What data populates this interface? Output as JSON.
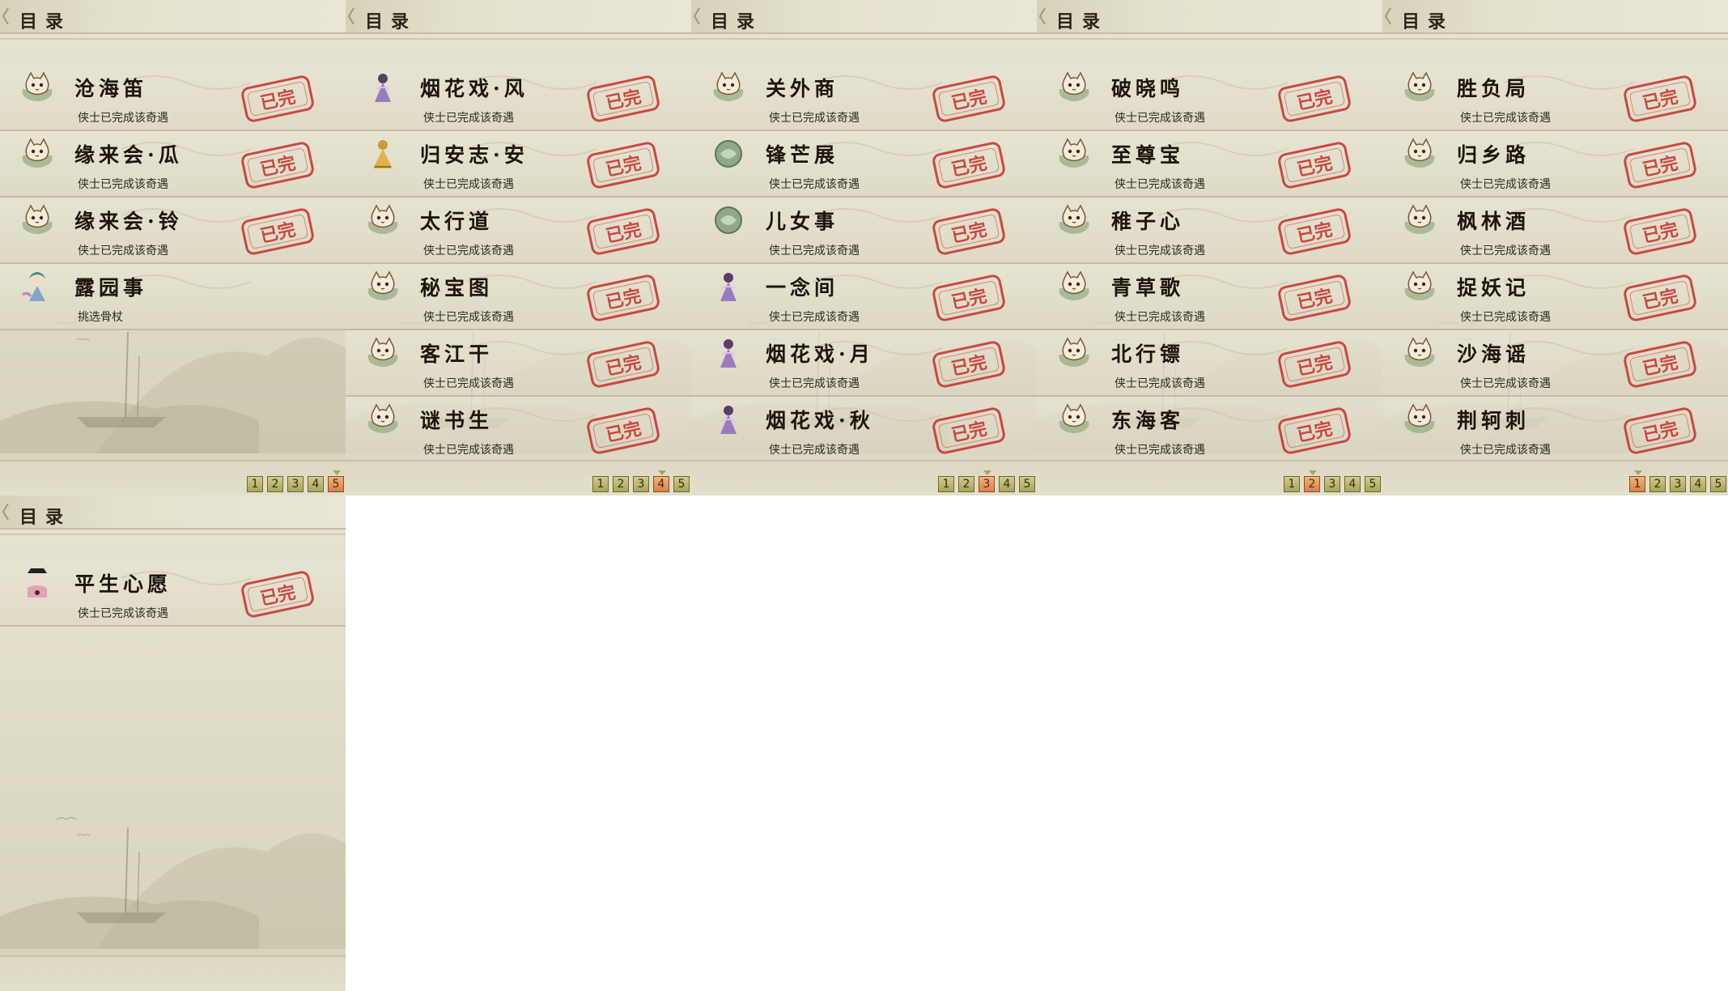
{
  "panel_title": "目录",
  "completed_stamp": "已完",
  "page_numbers": [
    "1",
    "2",
    "3",
    "4",
    "5"
  ],
  "colors": {
    "stamp_red": "#c72d28",
    "page_active": "#e19a62",
    "page_inactive": "#bdb977",
    "parchment": "#e2dfca"
  },
  "panels": [
    {
      "active_page": "5",
      "items": [
        {
          "title": "沧海笛",
          "subtitle": "侠士已完成该奇遇",
          "icon": "cat-avatar-icon",
          "completed": true
        },
        {
          "title": "缘来会·瓜",
          "subtitle": "侠士已完成该奇遇",
          "icon": "cat-avatar-icon",
          "completed": true
        },
        {
          "title": "缘来会·铃",
          "subtitle": "侠士已完成该奇遇",
          "icon": "cat-avatar-icon",
          "completed": true
        },
        {
          "title": "露园事",
          "subtitle": "挑选骨杖",
          "icon": "girl-avatar-icon",
          "completed": false
        }
      ]
    },
    {
      "active_page": "4",
      "items": [
        {
          "title": "烟花戏·风",
          "subtitle": "侠士已完成该奇遇",
          "icon": "purple-lady-avatar-icon",
          "completed": true
        },
        {
          "title": "归安志·安",
          "subtitle": "侠士已完成该奇遇",
          "icon": "golden-figure-avatar-icon",
          "completed": true
        },
        {
          "title": "太行道",
          "subtitle": "侠士已完成该奇遇",
          "icon": "cat-avatar-icon",
          "completed": true
        },
        {
          "title": "秘宝图",
          "subtitle": "侠士已完成该奇遇",
          "icon": "cat-avatar-icon",
          "completed": true
        },
        {
          "title": "客江干",
          "subtitle": "侠士已完成该奇遇",
          "icon": "cat-avatar-icon",
          "completed": true
        },
        {
          "title": "谜书生",
          "subtitle": "侠士已完成该奇遇",
          "icon": "cat-avatar-icon",
          "completed": true
        }
      ]
    },
    {
      "active_page": "3",
      "items": [
        {
          "title": "关外商",
          "subtitle": "侠士已完成该奇遇",
          "icon": "cat-avatar-icon",
          "completed": true
        },
        {
          "title": "锋芒展",
          "subtitle": "侠士已完成该奇遇",
          "icon": "jade-orb-avatar-icon",
          "completed": true
        },
        {
          "title": "儿女事",
          "subtitle": "侠士已完成该奇遇",
          "icon": "jade-orb-avatar-icon",
          "completed": true
        },
        {
          "title": "一念间",
          "subtitle": "侠士已完成该奇遇",
          "icon": "purple-lady-avatar-icon",
          "completed": true
        },
        {
          "title": "烟花戏·月",
          "subtitle": "侠士已完成该奇遇",
          "icon": "purple-lady-avatar-icon",
          "completed": true
        },
        {
          "title": "烟花戏·秋",
          "subtitle": "侠士已完成该奇遇",
          "icon": "purple-lady-avatar-icon",
          "completed": true
        }
      ]
    },
    {
      "active_page": "2",
      "items": [
        {
          "title": "破晓鸣",
          "subtitle": "侠士已完成该奇遇",
          "icon": "cat-avatar-icon",
          "completed": true
        },
        {
          "title": "至尊宝",
          "subtitle": "侠士已完成该奇遇",
          "icon": "cat-avatar-icon",
          "completed": true
        },
        {
          "title": "稚子心",
          "subtitle": "侠士已完成该奇遇",
          "icon": "cat-avatar-icon",
          "completed": true
        },
        {
          "title": "青草歌",
          "subtitle": "侠士已完成该奇遇",
          "icon": "cat-avatar-icon",
          "completed": true
        },
        {
          "title": "北行镖",
          "subtitle": "侠士已完成该奇遇",
          "icon": "cat-avatar-icon",
          "completed": true
        },
        {
          "title": "东海客",
          "subtitle": "侠士已完成该奇遇",
          "icon": "cat-avatar-icon",
          "completed": true
        }
      ]
    },
    {
      "active_page": "1",
      "items": [
        {
          "title": "胜负局",
          "subtitle": "侠士已完成该奇遇",
          "icon": "cat-avatar-icon",
          "completed": true
        },
        {
          "title": "归乡路",
          "subtitle": "侠士已完成该奇遇",
          "icon": "cat-avatar-icon",
          "completed": true
        },
        {
          "title": "枫林酒",
          "subtitle": "侠士已完成该奇遇",
          "icon": "cat-avatar-icon",
          "completed": true
        },
        {
          "title": "捉妖记",
          "subtitle": "侠士已完成该奇遇",
          "icon": "cat-avatar-icon",
          "completed": true
        },
        {
          "title": "沙海谣",
          "subtitle": "侠士已完成该奇遇",
          "icon": "cat-avatar-icon",
          "completed": true
        },
        {
          "title": "荆轲刺",
          "subtitle": "侠士已完成该奇遇",
          "icon": "cat-avatar-icon",
          "completed": true
        }
      ]
    },
    {
      "active_page": null,
      "items": [
        {
          "title": "平生心愿",
          "subtitle": "侠士已完成该奇遇",
          "icon": "chibi-warrior-avatar-icon",
          "completed": true
        }
      ]
    }
  ]
}
